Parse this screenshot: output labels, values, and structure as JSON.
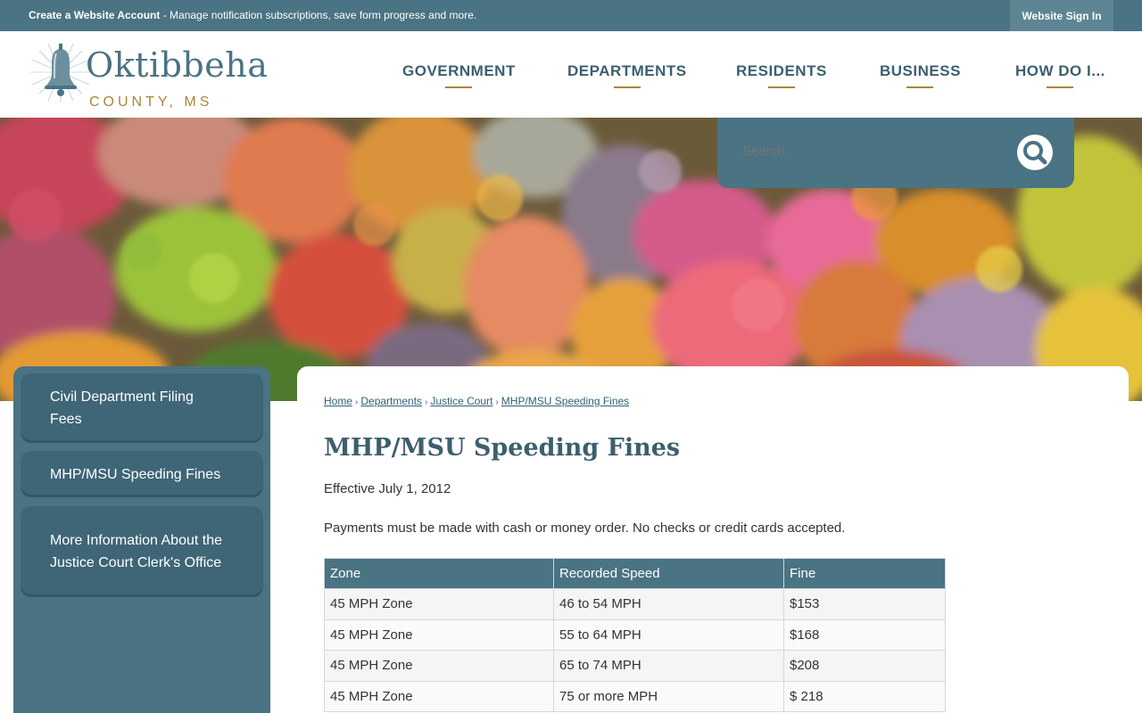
{
  "topbar": {
    "create_bold": "Create a Website Account",
    "create_rest": " - Manage notification subscriptions, save form progress and more.",
    "signin": "Website Sign In"
  },
  "logo": {
    "name": "Oktibbeha",
    "sub": "COUNTY, MS"
  },
  "nav": [
    {
      "label": "GOVERNMENT"
    },
    {
      "label": "DEPARTMENTS"
    },
    {
      "label": "RESIDENTS"
    },
    {
      "label": "BUSINESS"
    },
    {
      "label": "HOW DO I..."
    }
  ],
  "search": {
    "placeholder": "Search..."
  },
  "sidebar": [
    {
      "label": "Civil Department Filing Fees"
    },
    {
      "label": "MHP/MSU Speeding Fines"
    },
    {
      "label": "More Information About the Justice Court Clerk's Office"
    }
  ],
  "breadcrumb": [
    {
      "label": "Home"
    },
    {
      "label": "Departments"
    },
    {
      "label": "Justice Court"
    },
    {
      "label": "MHP/MSU Speeding Fines"
    }
  ],
  "page": {
    "title": "MHP/MSU Speeding Fines",
    "effective": "Effective July 1, 2012",
    "payments": "Payments must be made with cash or money order. No checks or credit cards accepted."
  },
  "table": {
    "headers": [
      "Zone",
      "Recorded Speed",
      "Fine"
    ],
    "rows": [
      [
        "45 MPH Zone",
        "46 to 54 MPH",
        "$153"
      ],
      [
        "45 MPH Zone",
        "55 to 64 MPH",
        "$168"
      ],
      [
        "45 MPH Zone",
        "65 to 74 MPH",
        "$208"
      ],
      [
        "45 MPH Zone",
        "75 or more MPH",
        "$ 218"
      ]
    ]
  },
  "colors": {
    "primary": "#4a7383",
    "accent": "#a9863a",
    "dark": "#3d5f6e"
  },
  "icons": {
    "search": "search-icon",
    "bell": "bell-icon"
  }
}
